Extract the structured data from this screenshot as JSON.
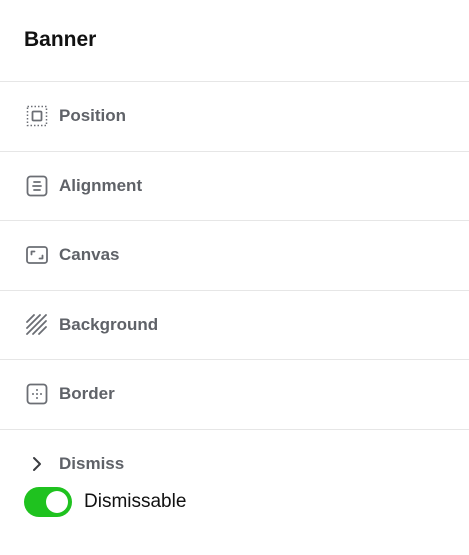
{
  "panel": {
    "title": "Banner"
  },
  "sections": [
    {
      "label": "Position",
      "icon": "position-icon"
    },
    {
      "label": "Alignment",
      "icon": "alignment-icon"
    },
    {
      "label": "Canvas",
      "icon": "canvas-icon"
    },
    {
      "label": "Background",
      "icon": "background-icon"
    },
    {
      "label": "Border",
      "icon": "border-icon"
    }
  ],
  "dismiss": {
    "label": "Dismiss",
    "icon": "chevron-right-icon",
    "toggle": {
      "label": "Dismissable",
      "checked": true,
      "color": "#1fc21f"
    }
  },
  "colors": {
    "label_muted": "#5f6268",
    "divider": "#e6e6e6",
    "toggle_on": "#1fc21f"
  }
}
